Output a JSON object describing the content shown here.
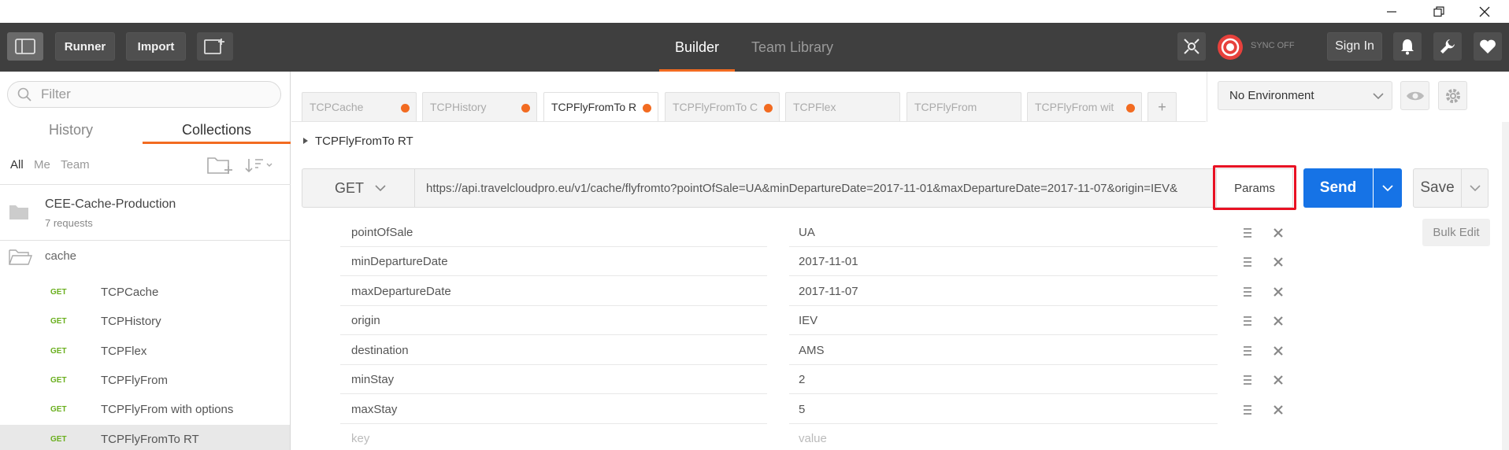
{
  "titlebar": {
    "minimize": "─",
    "restore": "❐",
    "close": "✕"
  },
  "toolbar": {
    "runner": "Runner",
    "import": "Import",
    "nav_builder": "Builder",
    "nav_team_library": "Team Library",
    "sync_label": "SYNC OFF",
    "sign_in": "Sign In"
  },
  "sidebar": {
    "filter_placeholder": "Filter",
    "tab_history": "History",
    "tab_collections": "Collections",
    "filter_all": "All",
    "filter_me": "Me",
    "filter_team": "Team",
    "collection": {
      "name": "CEE-Cache-Production",
      "count": "7 requests"
    },
    "folder": "cache",
    "requests": [
      {
        "method": "GET",
        "name": "TCPCache"
      },
      {
        "method": "GET",
        "name": "TCPHistory"
      },
      {
        "method": "GET",
        "name": "TCPFlex"
      },
      {
        "method": "GET",
        "name": "TCPFlyFrom"
      },
      {
        "method": "GET",
        "name": "TCPFlyFrom with options"
      },
      {
        "method": "GET",
        "name": "TCPFlyFromTo RT"
      }
    ]
  },
  "tabs": [
    {
      "label": "TCPCache",
      "dot": true
    },
    {
      "label": "TCPHistory",
      "dot": true
    },
    {
      "label": "TCPFlyFromTo R",
      "dot": true
    },
    {
      "label": "TCPFlyFromTo C",
      "dot": true
    },
    {
      "label": "TCPFlex",
      "dot": false
    },
    {
      "label": "TCPFlyFrom",
      "dot": false
    },
    {
      "label": "TCPFlyFrom wit",
      "dot": true
    }
  ],
  "add_tab": "+",
  "environment": {
    "selected": "No Environment"
  },
  "request": {
    "title": "TCPFlyFromTo RT",
    "method": "GET",
    "url": "https://api.travelcloudpro.eu/v1/cache/flyfromto?pointOfSale=UA&minDepartureDate=2017-11-01&maxDepartureDate=2017-11-07&origin=IEV&",
    "params_label": "Params",
    "send_label": "Send",
    "save_label": "Save",
    "bulk_edit": "Bulk Edit"
  },
  "params": [
    {
      "key": "pointOfSale",
      "value": "UA"
    },
    {
      "key": "minDepartureDate",
      "value": "2017-11-01"
    },
    {
      "key": "maxDepartureDate",
      "value": "2017-11-07"
    },
    {
      "key": "origin",
      "value": "IEV"
    },
    {
      "key": "destination",
      "value": "AMS"
    },
    {
      "key": "minStay",
      "value": "2"
    },
    {
      "key": "maxStay",
      "value": "5"
    }
  ],
  "params_placeholder": {
    "key": "key",
    "value": "value"
  },
  "colors": {
    "accent": "#f26b21",
    "send": "#1673e6",
    "toolbar": "#3f3f3f",
    "get_method": "#6aaf1e",
    "highlight_box": "#e81123"
  }
}
